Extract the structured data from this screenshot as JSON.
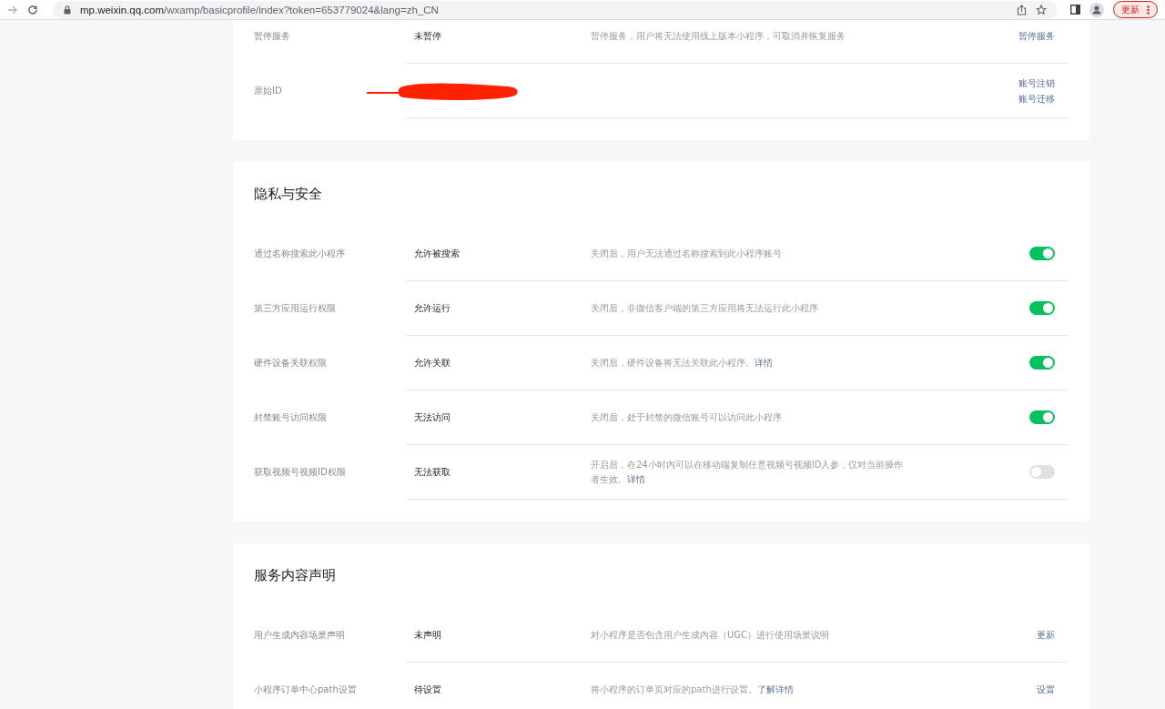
{
  "browser": {
    "url_host": "mp.weixin.qq.com",
    "url_path": "/wxamp/basicprofile/index?token=653779024&lang=zh_CN",
    "update_button": "更新"
  },
  "sections": [
    {
      "rows": [
        {
          "kind": "action",
          "label": "暂停服务",
          "value": "未暂停",
          "description": {
            "text": "暂停服务，用户将无法使用线上版本小程序，可取消并恢复服务"
          },
          "actions": [
            "暂停服务"
          ]
        },
        {
          "kind": "action",
          "label": "原始ID",
          "redacted": true,
          "actions": [
            "账号注销",
            "账号迁移"
          ]
        }
      ]
    },
    {
      "title": "隐私与安全",
      "rows": [
        {
          "kind": "toggle",
          "label": "通过名称搜索此小程序",
          "value": "允许被搜索",
          "description": {
            "text": "关闭后，用户无法通过名称搜索到此小程序账号"
          },
          "on": true
        },
        {
          "kind": "toggle",
          "label": "第三方应用运行权限",
          "value": "允许运行",
          "description": {
            "text": "关闭后，非微信客户端的第三方应用将无法运行此小程序"
          },
          "on": true
        },
        {
          "kind": "toggle",
          "label": "硬件设备关联权限",
          "value": "允许关联",
          "description": {
            "text": "关闭后，硬件设备将无法关联此小程序。",
            "link": "详情"
          },
          "on": true
        },
        {
          "kind": "toggle",
          "label": "封禁账号访问权限",
          "value": "无法访问",
          "description": {
            "text": "关闭后，处于封禁的微信账号可以访问此小程序"
          },
          "on": true
        },
        {
          "kind": "toggle",
          "label": "获取视频号视频ID权限",
          "value": "无法获取",
          "description": {
            "text": "开启后，在24小时内可以在移动端复制任意视频号视频ID入参，仅对当前操作者生效。",
            "link": "详情"
          },
          "on": false
        }
      ]
    },
    {
      "title": "服务内容声明",
      "rows": [
        {
          "kind": "action",
          "label": "用户生成内容场景声明",
          "value": "未声明",
          "description": {
            "text": "对小程序是否包含用户生成内容（UGC）进行使用场景说明"
          },
          "actions": [
            "更新"
          ]
        },
        {
          "kind": "action",
          "label": "小程序订单中心path设置",
          "value": "待设置",
          "description": {
            "text": "将小程序的订单页对应的path进行设置。",
            "link": "了解详情"
          },
          "actions": [
            "设置"
          ]
        }
      ]
    }
  ]
}
